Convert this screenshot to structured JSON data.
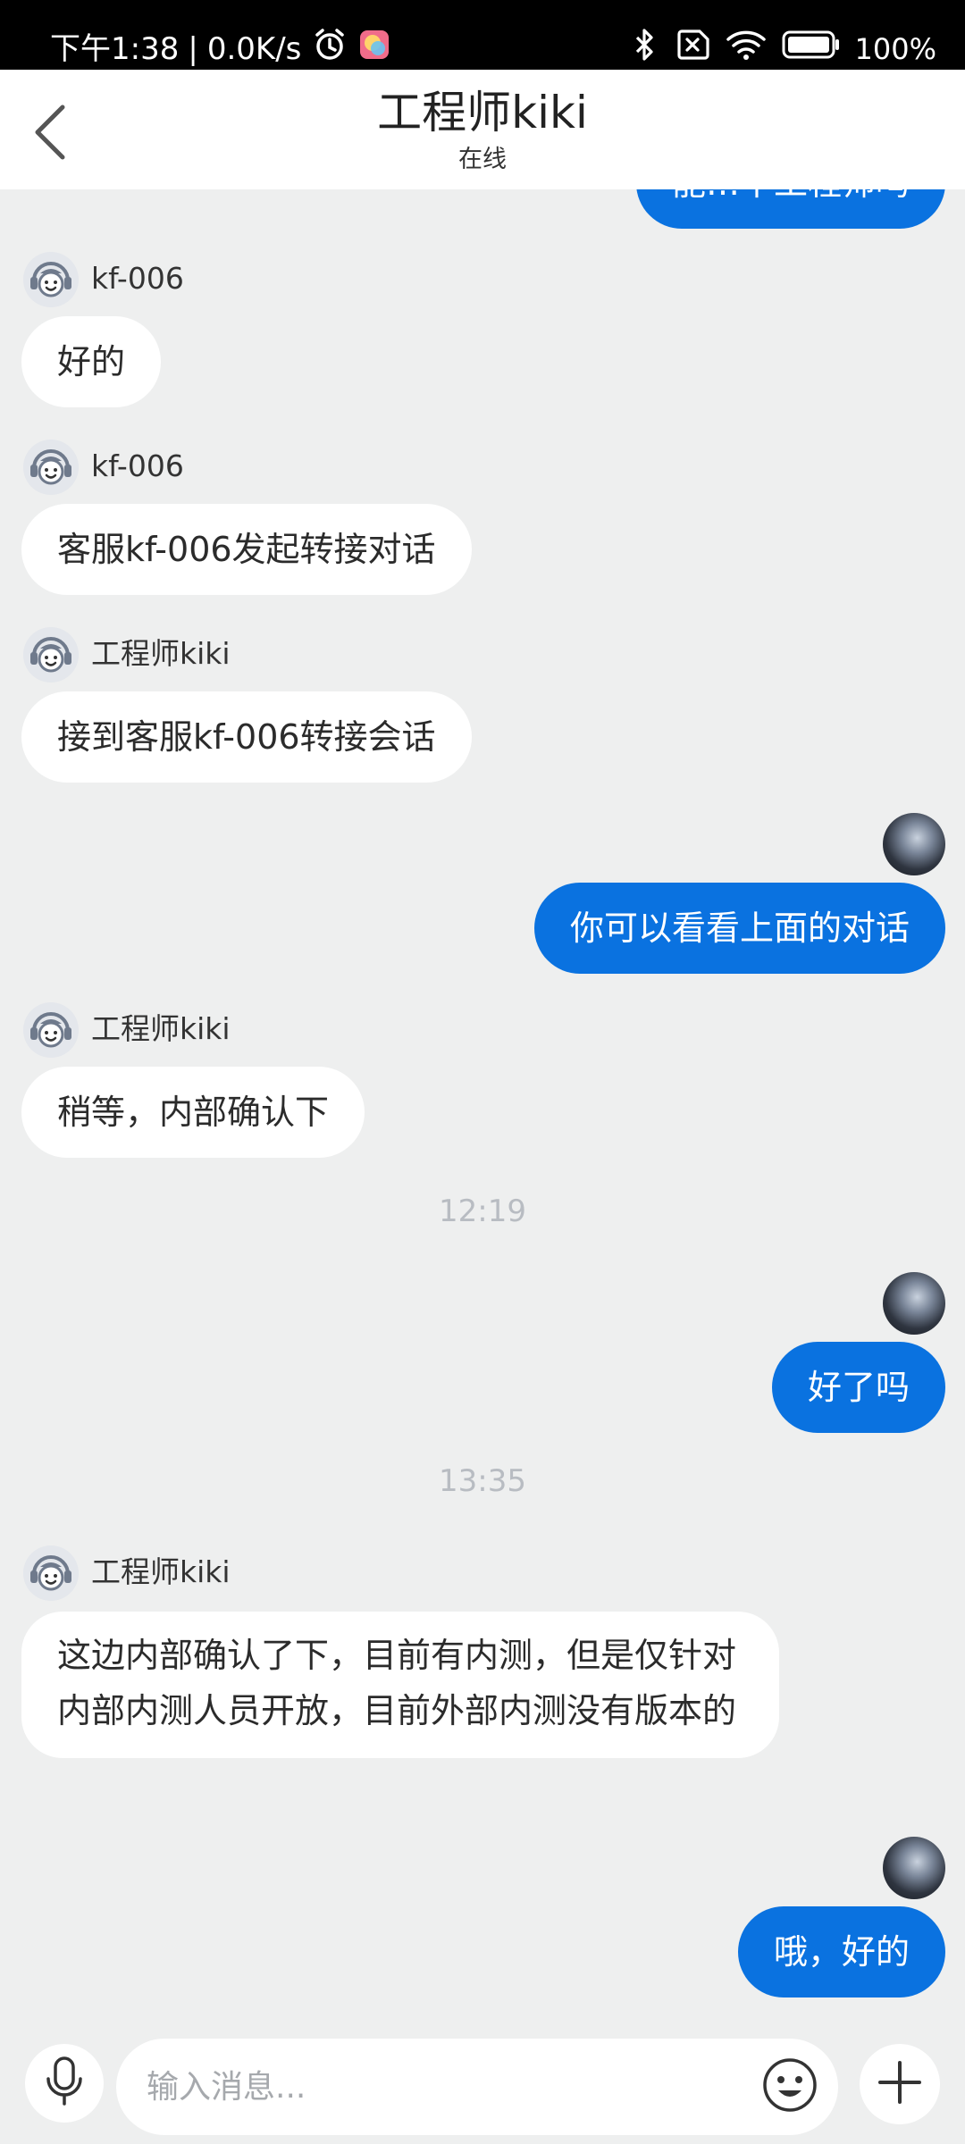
{
  "status_bar": {
    "time": "下午1:38",
    "separator": "|",
    "network_speed": "0.0K/s",
    "battery": "100%",
    "icons": [
      "alarm-icon",
      "gallery-app-icon",
      "bluetooth-icon",
      "no-sim-icon",
      "wifi-icon",
      "battery-icon"
    ]
  },
  "header": {
    "title": "工程师kiki",
    "status": "在线",
    "back_icon": "chevron-left-icon"
  },
  "messages": [
    {
      "type": "out",
      "text": "能…不工程师吗",
      "partial": true
    },
    {
      "type": "in",
      "sender": "kf-006",
      "text": "好的"
    },
    {
      "type": "in",
      "sender": "kf-006",
      "text": "客服kf-006发起转接对话"
    },
    {
      "type": "in",
      "sender": "工程师kiki",
      "text": "接到客服kf-006转接会话"
    },
    {
      "type": "out",
      "text": "你可以看看上面的对话"
    },
    {
      "type": "in",
      "sender": "工程师kiki",
      "text": "稍等，内部确认下"
    },
    {
      "type": "timestamp",
      "text": "12:19"
    },
    {
      "type": "out",
      "text": "好了吗"
    },
    {
      "type": "timestamp",
      "text": "13:35"
    },
    {
      "type": "in",
      "sender": "工程师kiki",
      "text": "这边内部确认了下，目前有内测，但是仅针对内部内测人员开放，目前外部内测没有版本的"
    },
    {
      "type": "out",
      "text": "哦，好的"
    }
  ],
  "input_bar": {
    "placeholder": "输入消息...",
    "icons": [
      "microphone-icon",
      "emoji-icon",
      "plus-icon"
    ]
  },
  "colors": {
    "accent": "#0a72e0",
    "background": "#eeefef",
    "bubble_in": "#ffffff",
    "timestamp": "#b8bcc2"
  }
}
